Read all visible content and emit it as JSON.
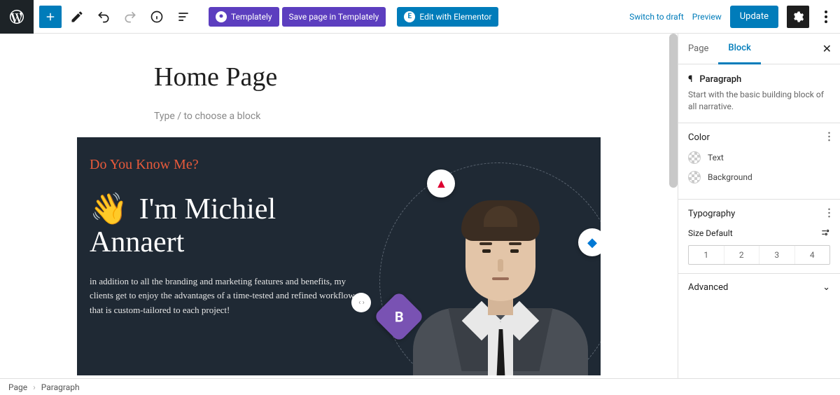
{
  "toolbar": {
    "templately": "Templately",
    "save_templately": "Save page in Templately",
    "edit_elementor": "Edit with Elementor",
    "switch_to_draft": "Switch to draft",
    "preview": "Preview",
    "update": "Update"
  },
  "canvas": {
    "title": "Home Page",
    "placeholder": "Type / to choose a block"
  },
  "hero": {
    "eyebrow": "Do You Know Me?",
    "headline_line1": "I'm Michiel",
    "headline_line2": "Annaert",
    "wave_emoji": "👋",
    "body": "in addition to all the branding and marketing features and benefits, my clients get to enjoy the advantages of a time-tested and refined workflow that is custom-tailored to each project!"
  },
  "sidebar": {
    "tab_page": "Page",
    "tab_block": "Block",
    "block_name": "Paragraph",
    "block_desc": "Start with the basic building block of all narrative.",
    "color_section": "Color",
    "color_text": "Text",
    "color_background": "Background",
    "typography_section": "Typography",
    "size_label": "Size Default",
    "sizes": [
      "1",
      "2",
      "3",
      "4"
    ],
    "advanced": "Advanced"
  },
  "footer": {
    "crumb1": "Page",
    "crumb2": "Paragraph"
  }
}
